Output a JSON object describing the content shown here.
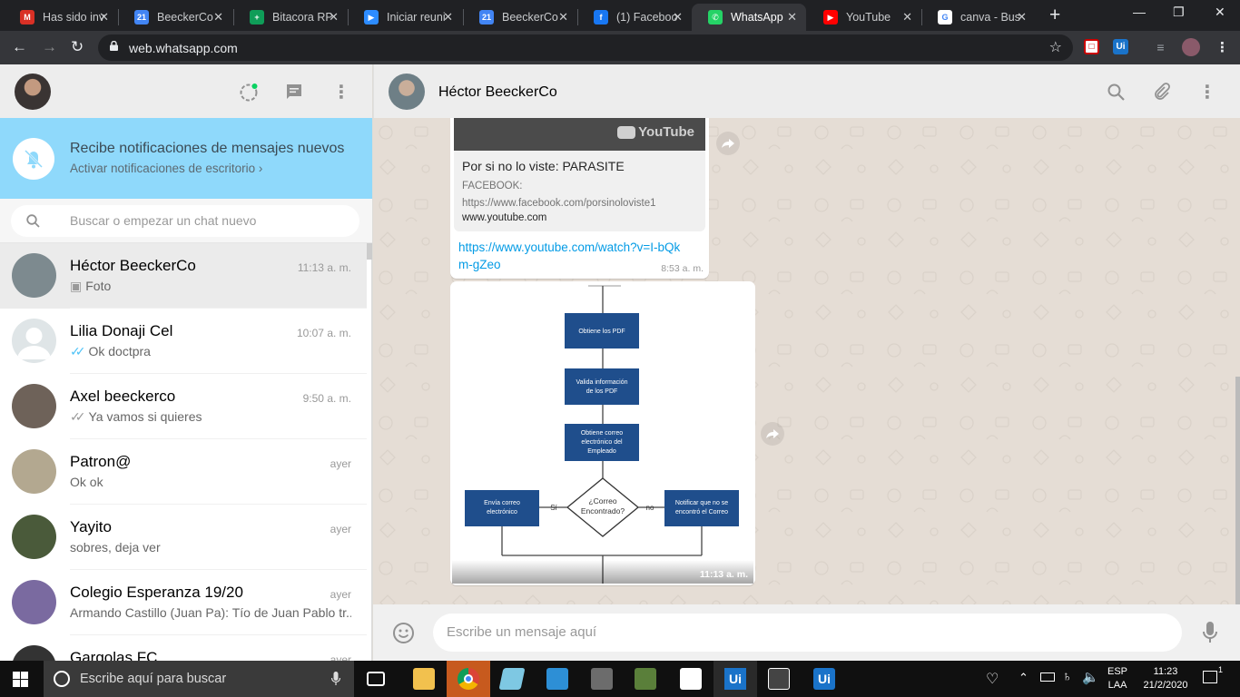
{
  "browser": {
    "tabs": [
      {
        "title": "Has sido inv",
        "icon": "gmail-icon",
        "color": "#d93025",
        "glyph": "M"
      },
      {
        "title": "BeeckerCo",
        "icon": "calendar-icon",
        "color": "#4285f4",
        "glyph": "21"
      },
      {
        "title": "Bitacora RP",
        "icon": "sheets-icon",
        "color": "#0f9d58",
        "glyph": "+"
      },
      {
        "title": "Iniciar reuni",
        "icon": "zoom-icon",
        "color": "#2d8cff",
        "glyph": "▶"
      },
      {
        "title": "BeeckerCo",
        "icon": "calendar-icon",
        "color": "#4285f4",
        "glyph": "21"
      },
      {
        "title": "(1) Faceboo",
        "icon": "facebook-icon",
        "color": "#1877f2",
        "glyph": "f"
      },
      {
        "title": "WhatsApp",
        "icon": "whatsapp-icon",
        "color": "#25d366",
        "glyph": "✆"
      },
      {
        "title": "YouTube",
        "icon": "youtube-icon",
        "color": "#ff0000",
        "glyph": "▶"
      },
      {
        "title": "canva - Bus",
        "icon": "google-icon",
        "color": "#ffffff",
        "glyph": "G"
      }
    ],
    "url": "web.whatsapp.com"
  },
  "sidebar": {
    "notification": {
      "title": "Recibe notificaciones de mensajes nuevos",
      "action": "Activar notificaciones de escritorio"
    },
    "search_placeholder": "Buscar o empezar un chat nuevo",
    "chats": [
      {
        "name": "Héctor BeeckerCo",
        "preview": "Foto",
        "time": "11:13 a. m.",
        "icon": "camera-icon",
        "avatar": "#7d8a8f"
      },
      {
        "name": "Lilia Donaji Cel",
        "preview": "Ok doctpra",
        "time": "10:07 a. m.",
        "icon": "double-check-blue-icon",
        "avatar": "#dfe5e7"
      },
      {
        "name": "Axel beeckerco",
        "preview": "Ya vamos si quieres",
        "time": "9:50 a. m.",
        "icon": "double-check-gray-icon",
        "avatar": "#6e6259"
      },
      {
        "name": "Patron@",
        "preview": "Ok ok",
        "time": "ayer",
        "icon": "",
        "avatar": "#b3a890"
      },
      {
        "name": "Yayito",
        "preview": "sobres, deja ver",
        "time": "ayer",
        "icon": "",
        "avatar": "#4a5a3a"
      },
      {
        "name": "Colegio Esperanza 19/20",
        "preview": "Armando Castillo (Juan Pa): Tío de Juan Pablo tr...",
        "time": "ayer",
        "icon": "",
        "avatar": "#7a6aa0"
      },
      {
        "name": "Gargolas FC",
        "preview": "",
        "time": "ayer",
        "icon": "",
        "avatar": "#333333"
      }
    ]
  },
  "conversation": {
    "contact": "Héctor BeeckerCo",
    "youtube_label": "YouTube",
    "link_title": "Por si no lo viste: PARASITE",
    "link_desc": "FACEBOOK: https://www.facebook.com/porsinoloviste1",
    "link_site": "www.youtube.com",
    "link_url": "https://www.youtube.com/watch?v=I-bQkm-gZeo",
    "msg1_time": "8:53 a. m.",
    "image_time": "11:13 a. m.",
    "flow": {
      "box1": "Obtiene los PDF",
      "box2a": "Valida información",
      "box2b": "de los PDF",
      "box3a": "Obtiene correo",
      "box3b": "electrónico del",
      "box3c": "Empleado",
      "decision_a": "¿Correo",
      "decision_b": "Encontrado?",
      "left_a": "Envía correo",
      "left_b": "electrónico",
      "right_a": "Notificar que no se",
      "right_b": "encontró el Correo",
      "yes": "Sí",
      "no": "no"
    },
    "input_placeholder": "Escribe un mensaje aquí"
  },
  "taskbar": {
    "search_placeholder": "Escribe aquí para buscar",
    "lang1": "ESP",
    "lang2": "LAA",
    "time": "11:23",
    "date": "21/2/2020",
    "notifications": "1"
  }
}
